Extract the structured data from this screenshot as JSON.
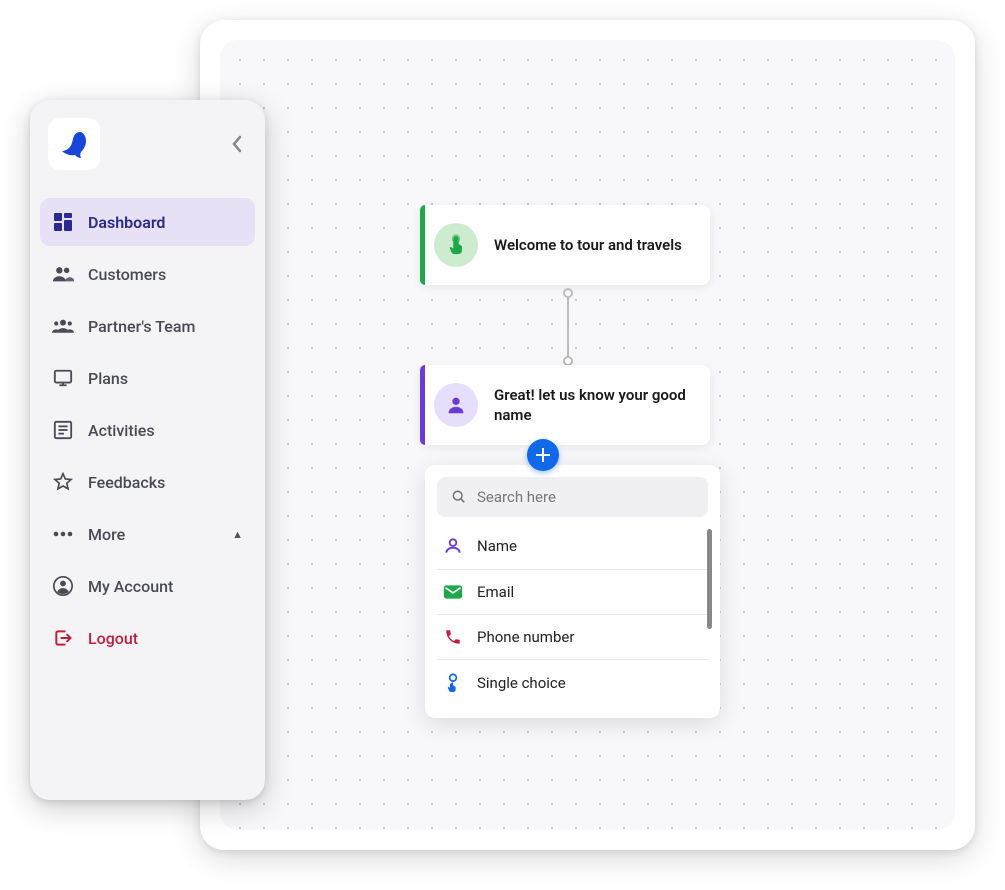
{
  "sidebar": {
    "items": [
      {
        "label": "Dashboard",
        "icon": "dashboard-icon",
        "active": true
      },
      {
        "label": "Customers",
        "icon": "customers-icon"
      },
      {
        "label": "Partner's Team",
        "icon": "team-icon"
      },
      {
        "label": "Plans",
        "icon": "plans-icon"
      },
      {
        "label": "Activities",
        "icon": "activities-icon"
      },
      {
        "label": "Feedbacks",
        "icon": "feedbacks-icon"
      },
      {
        "label": "More",
        "icon": "more-icon",
        "expandable": true
      },
      {
        "label": "My Account",
        "icon": "account-icon"
      },
      {
        "label": "Logout",
        "icon": "logout-icon",
        "danger": true
      }
    ]
  },
  "flow": {
    "card1_text": "Welcome to tour and travels",
    "card2_text": "Great! let us know your good name"
  },
  "dropdown": {
    "search_placeholder": "Search here",
    "options": [
      {
        "label": "Name",
        "icon": "name-icon"
      },
      {
        "label": "Email",
        "icon": "email-icon"
      },
      {
        "label": "Phone number",
        "icon": "phone-icon"
      },
      {
        "label": "Single choice",
        "icon": "choice-icon"
      }
    ]
  }
}
